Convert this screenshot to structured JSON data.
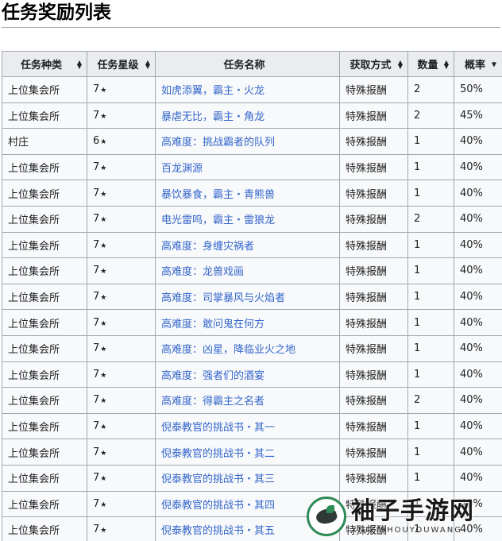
{
  "page": {
    "title": "任务奖励列表"
  },
  "table": {
    "headers": [
      {
        "label": "任务种类",
        "sort": "both"
      },
      {
        "label": "任务星级",
        "sort": "both"
      },
      {
        "label": "任务名称",
        "sort": "none"
      },
      {
        "label": "获取方式",
        "sort": "both"
      },
      {
        "label": "数量",
        "sort": "both"
      },
      {
        "label": "概率",
        "sort": "desc"
      }
    ],
    "rows": [
      {
        "type": "上位集会所",
        "stars": "7",
        "name": "如虎添翼，霸主・火龙",
        "method": "特殊报酬",
        "qty": "2",
        "prob": "50%"
      },
      {
        "type": "上位集会所",
        "stars": "7",
        "name": "暴虐无比，霸主・角龙",
        "method": "特殊报酬",
        "qty": "2",
        "prob": "45%"
      },
      {
        "type": "村庄",
        "stars": "6",
        "name": "高难度：挑战霸者的队列",
        "method": "特殊报酬",
        "qty": "1",
        "prob": "40%"
      },
      {
        "type": "上位集会所",
        "stars": "7",
        "name": "百龙渊源",
        "method": "特殊报酬",
        "qty": "1",
        "prob": "40%"
      },
      {
        "type": "上位集会所",
        "stars": "7",
        "name": "暴饮暴食，霸主・青熊兽",
        "method": "特殊报酬",
        "qty": "1",
        "prob": "40%"
      },
      {
        "type": "上位集会所",
        "stars": "7",
        "name": "电光雷鸣，霸主・雷狼龙",
        "method": "特殊报酬",
        "qty": "2",
        "prob": "40%"
      },
      {
        "type": "上位集会所",
        "stars": "7",
        "name": "高难度：身缠灾祸者",
        "method": "特殊报酬",
        "qty": "1",
        "prob": "40%"
      },
      {
        "type": "上位集会所",
        "stars": "7",
        "name": "高难度：龙兽戏画",
        "method": "特殊报酬",
        "qty": "1",
        "prob": "40%"
      },
      {
        "type": "上位集会所",
        "stars": "7",
        "name": "高难度：司掌暴风与火焰者",
        "method": "特殊报酬",
        "qty": "1",
        "prob": "40%"
      },
      {
        "type": "上位集会所",
        "stars": "7",
        "name": "高难度：敢问鬼在何方",
        "method": "特殊报酬",
        "qty": "1",
        "prob": "40%"
      },
      {
        "type": "上位集会所",
        "stars": "7",
        "name": "高难度：凶星，降临业火之地",
        "method": "特殊报酬",
        "qty": "1",
        "prob": "40%"
      },
      {
        "type": "上位集会所",
        "stars": "7",
        "name": "高难度：强者们的酒宴",
        "method": "特殊报酬",
        "qty": "1",
        "prob": "40%"
      },
      {
        "type": "上位集会所",
        "stars": "7",
        "name": "高难度：得霸主之名者",
        "method": "特殊报酬",
        "qty": "2",
        "prob": "40%"
      },
      {
        "type": "上位集会所",
        "stars": "7",
        "name": "倪泰教官的挑战书・其一",
        "method": "特殊报酬",
        "qty": "1",
        "prob": "40%"
      },
      {
        "type": "上位集会所",
        "stars": "7",
        "name": "倪泰教官的挑战书・其二",
        "method": "特殊报酬",
        "qty": "1",
        "prob": "40%"
      },
      {
        "type": "上位集会所",
        "stars": "7",
        "name": "倪泰教官的挑战书・其三",
        "method": "特殊报酬",
        "qty": "1",
        "prob": "40%"
      },
      {
        "type": "上位集会所",
        "stars": "7",
        "name": "倪泰教官的挑战书・其四",
        "method": "特殊报酬",
        "qty": "1",
        "prob": "40%"
      },
      {
        "type": "上位集会所",
        "stars": "7",
        "name": "倪泰教官的挑战书・其五",
        "method": "特殊报酬",
        "qty": "1",
        "prob": "40%"
      }
    ]
  },
  "icons": {
    "star": "star-icon",
    "sort": "sort-icon"
  },
  "colors": {
    "link": "#3366cc",
    "header_bg": "#eaecf0",
    "cell_bg": "#f8f9fa",
    "border": "#a2a9b1"
  },
  "watermark": {
    "name": "袖子手游网",
    "sub": "XIUZISHOUYOUWANG"
  }
}
